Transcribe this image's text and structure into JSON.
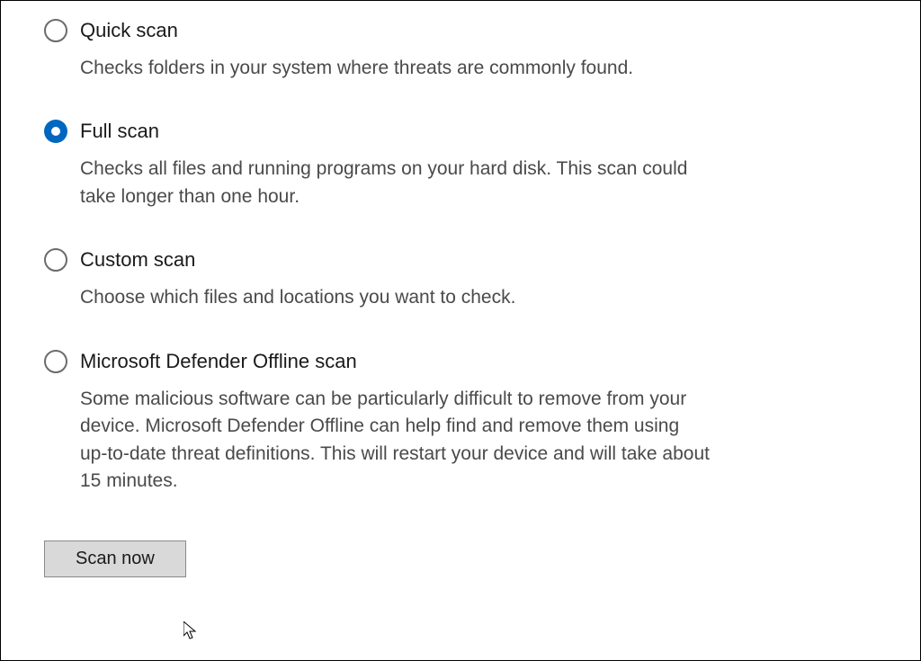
{
  "options": [
    {
      "id": "quick",
      "label": "Quick scan",
      "description": "Checks folders in your system where threats are commonly found.",
      "selected": false
    },
    {
      "id": "full",
      "label": "Full scan",
      "description": "Checks all files and running programs on your hard disk. This scan could take longer than one hour.",
      "selected": true
    },
    {
      "id": "custom",
      "label": "Custom scan",
      "description": "Choose which files and locations you want to check.",
      "selected": false
    },
    {
      "id": "offline",
      "label": "Microsoft Defender Offline scan",
      "description": "Some malicious software can be particularly difficult to remove from your device. Microsoft Defender Offline can help find and remove them using up-to-date threat definitions. This will restart your device and will take about 15 minutes.",
      "selected": false
    }
  ],
  "buttons": {
    "scan_now": "Scan now"
  },
  "colors": {
    "accent": "#0067c0",
    "button_bg": "#d9d9d9"
  }
}
